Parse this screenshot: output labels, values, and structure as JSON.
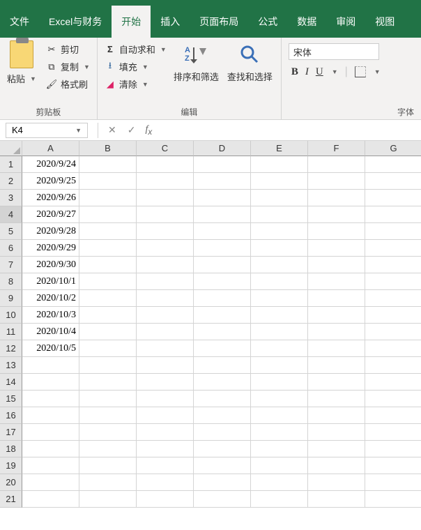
{
  "tabs": {
    "file": "文件",
    "excel_finance": "Excel与财务",
    "home": "开始",
    "insert": "插入",
    "page_layout": "页面布局",
    "formulas": "公式",
    "data": "数据",
    "review": "审阅",
    "view": "视图"
  },
  "ribbon": {
    "clipboard": {
      "paste": "粘贴",
      "cut": "剪切",
      "copy": "复制",
      "format_painter": "格式刷",
      "group_label": "剪贴板"
    },
    "editing": {
      "autosum": "自动求和",
      "fill": "填充",
      "clear": "清除",
      "sort_filter": "排序和筛选",
      "find_select": "查找和选择",
      "group_label": "编辑"
    },
    "font": {
      "name": "宋体",
      "bold": "B",
      "italic": "I",
      "underline": "U",
      "group_label": "字体"
    }
  },
  "namebox": {
    "value": "K4"
  },
  "formula_bar": {
    "value": ""
  },
  "columns": [
    "A",
    "B",
    "C",
    "D",
    "E",
    "F",
    "G"
  ],
  "rows": [
    "1",
    "2",
    "3",
    "4",
    "5",
    "6",
    "7",
    "8",
    "9",
    "10",
    "11",
    "12",
    "13",
    "14",
    "15",
    "16",
    "17",
    "18",
    "19",
    "20",
    "21"
  ],
  "selected_row": 4,
  "cells": {
    "A1": "2020/9/24",
    "A2": "2020/9/25",
    "A3": "2020/9/26",
    "A4": "2020/9/27",
    "A5": "2020/9/28",
    "A6": "2020/9/29",
    "A7": "2020/9/30",
    "A8": "2020/10/1",
    "A9": "2020/10/2",
    "A10": "2020/10/3",
    "A11": "2020/10/4",
    "A12": "2020/10/5"
  },
  "chart_data": {
    "type": "table",
    "title": "",
    "columns": [
      "A"
    ],
    "rows": [
      [
        "2020/9/24"
      ],
      [
        "2020/9/25"
      ],
      [
        "2020/9/26"
      ],
      [
        "2020/9/27"
      ],
      [
        "2020/9/28"
      ],
      [
        "2020/9/29"
      ],
      [
        "2020/9/30"
      ],
      [
        "2020/10/1"
      ],
      [
        "2020/10/2"
      ],
      [
        "2020/10/3"
      ],
      [
        "2020/10/4"
      ],
      [
        "2020/10/5"
      ]
    ]
  }
}
